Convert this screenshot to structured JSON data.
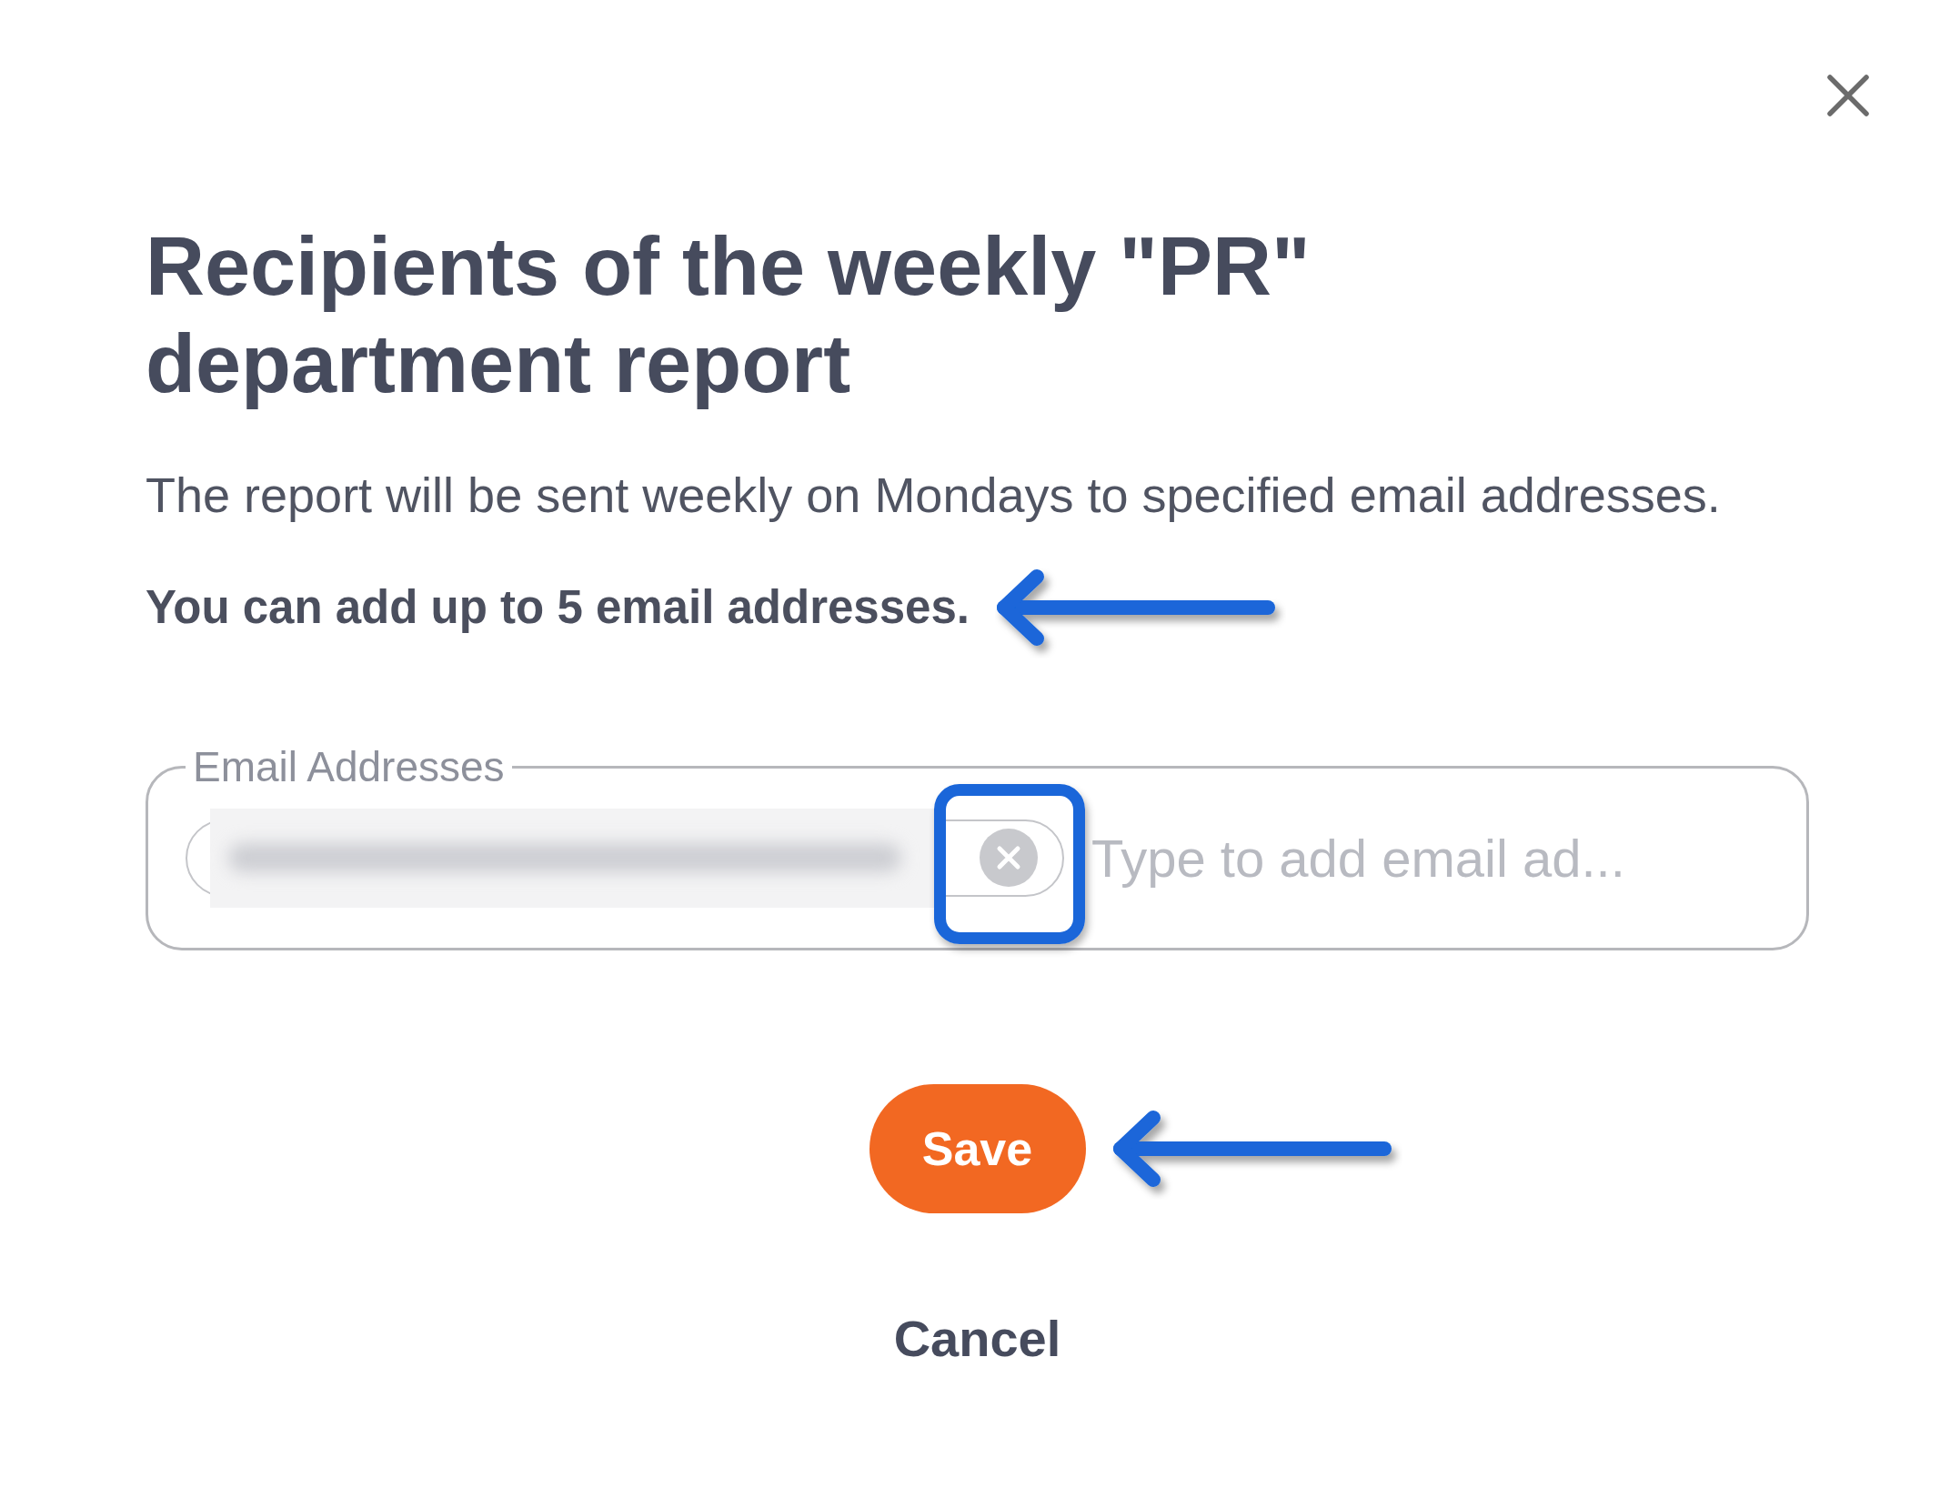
{
  "dialog": {
    "close_button": true,
    "title": "Recipients of the weekly \"PR\" department report",
    "description": "The report will be sent weekly on Mondays to specified email addresses.",
    "limit_note": {
      "text": "You can add up to 5 email addresses.",
      "arrow": true
    }
  },
  "email_field": {
    "label": "Email Addresses",
    "chips": [
      {
        "kind": "redacted",
        "highlighted": true
      }
    ],
    "placeholder": "Type to add email ad..."
  },
  "buttons": [
    {
      "kind": "primary",
      "label": "Save",
      "arrow": true
    },
    {
      "kind": "link",
      "label": "Cancel",
      "arrow": false
    }
  ]
}
